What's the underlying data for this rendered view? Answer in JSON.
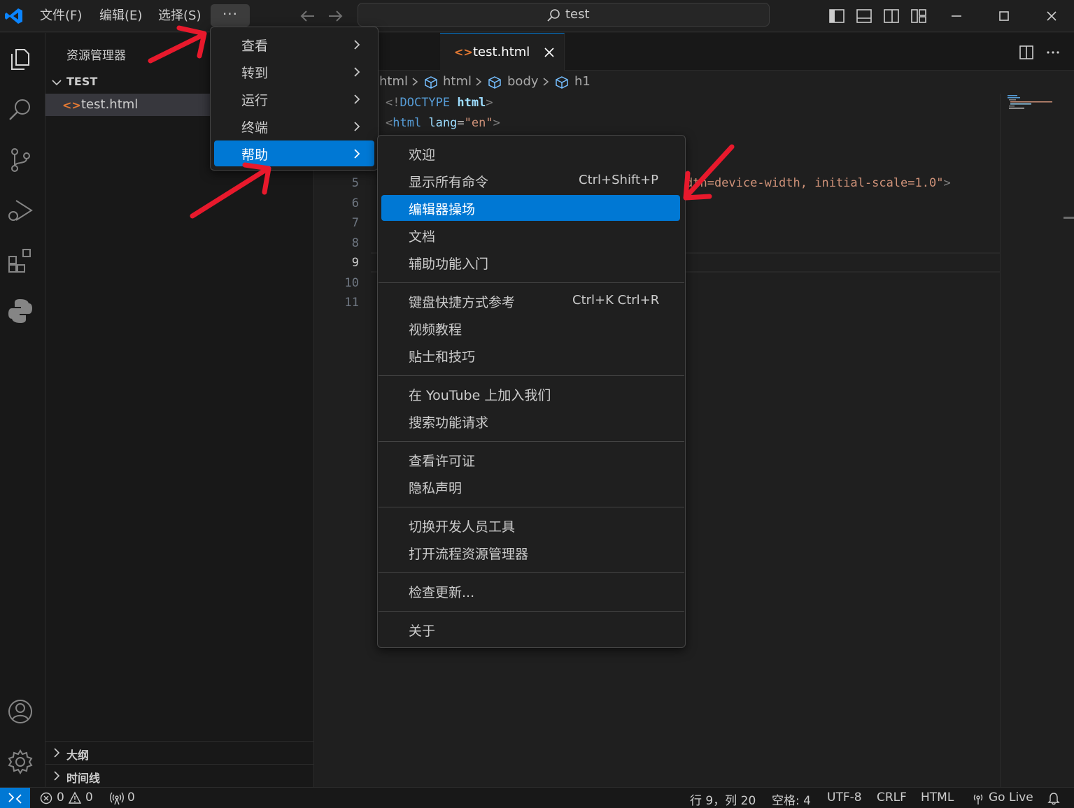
{
  "titlebar": {
    "menus": [
      "文件(F)",
      "编辑(E)",
      "选择(S)"
    ],
    "more_label": "···",
    "search_text": "test"
  },
  "sidebar": {
    "title": "资源管理器",
    "folder": "TEST",
    "file_icon": "<>",
    "file": "test.html",
    "sections": [
      "大纲",
      "时间线"
    ]
  },
  "editor": {
    "tab_icon": "<>",
    "tab_label": "test.html",
    "breadcrumbs": [
      "html",
      "html",
      "body",
      "h1"
    ],
    "line_numbers": [
      "5",
      "6",
      "7",
      "8",
      "9",
      "10",
      "11"
    ],
    "active_line": "9",
    "code": {
      "l1_a": "<!",
      "l1_b": "DOCTYPE",
      "l1_c": " html",
      "l1_d": ">",
      "l2_a": "<",
      "l2_b": "html",
      "l2_c": " lang",
      "l2_d": "=",
      "l2_e": "\"en\"",
      "l2_f": ">",
      "l5_a": "dth=device-width, initial-scale=1.0\"",
      "l5_b": ">"
    }
  },
  "more_menu": {
    "items": [
      "查看",
      "转到",
      "运行",
      "终端",
      "帮助"
    ],
    "highlighted": "帮助"
  },
  "help_menu": {
    "groups": [
      [
        {
          "label": "欢迎",
          "key": ""
        },
        {
          "label": "显示所有命令",
          "key": "Ctrl+Shift+P"
        },
        {
          "label": "编辑器操场",
          "key": ""
        },
        {
          "label": "文档",
          "key": ""
        },
        {
          "label": "辅助功能入门",
          "key": ""
        }
      ],
      [
        {
          "label": "键盘快捷方式参考",
          "key": "Ctrl+K Ctrl+R"
        },
        {
          "label": "视频教程",
          "key": ""
        },
        {
          "label": "贴士和技巧",
          "key": ""
        }
      ],
      [
        {
          "label": "在 YouTube 上加入我们",
          "key": ""
        },
        {
          "label": "搜索功能请求",
          "key": ""
        }
      ],
      [
        {
          "label": "查看许可证",
          "key": ""
        },
        {
          "label": "隐私声明",
          "key": ""
        }
      ],
      [
        {
          "label": "切换开发人员工具",
          "key": ""
        },
        {
          "label": "打开流程资源管理器",
          "key": ""
        }
      ],
      [
        {
          "label": "检查更新...",
          "key": ""
        }
      ],
      [
        {
          "label": "关于",
          "key": ""
        }
      ]
    ],
    "highlighted": "编辑器操场"
  },
  "statusbar": {
    "errors": "0",
    "warnings": "0",
    "ports": "0",
    "position": "行 9，列 20",
    "spaces": "空格: 4",
    "encoding": "UTF-8",
    "eol": "CRLF",
    "language": "HTML",
    "golive": "Go Live"
  },
  "colors": {
    "accent": "#0078d4",
    "annotation": "#e8192c",
    "file_icon": "#e37933"
  }
}
